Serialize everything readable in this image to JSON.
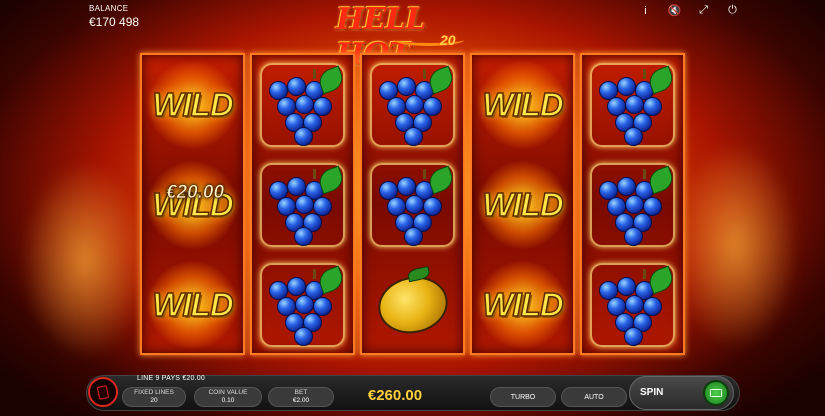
{
  "balance": {
    "label": "BALANCE",
    "value": "€170 498"
  },
  "logo": {
    "title": "HELL HOT",
    "number": "20"
  },
  "toolbar": {
    "info": "i",
    "mute": "🔇",
    "fullscreen": "⤢",
    "power": "⏻"
  },
  "reels": [
    [
      "wild",
      "wild",
      "wild"
    ],
    [
      "grape",
      "grape",
      "grape"
    ],
    [
      "grape",
      "grape",
      "lemon"
    ],
    [
      "wild",
      "wild",
      "wild"
    ],
    [
      "grape",
      "grape",
      "grape"
    ]
  ],
  "symbol_text": {
    "wild": "WILD"
  },
  "line_win_value": "€20.00",
  "message": "LINE 9 PAYS €20.00",
  "bottom": {
    "fixed_lines_label": "FIXED LINES",
    "fixed_lines_value": "20",
    "coin_value_label": "COIN VALUE",
    "coin_value": "0.10",
    "bet_label": "BET",
    "bet_value": "€2.00",
    "win": "€260.00",
    "turbo": "TURBO",
    "auto": "AUTO",
    "spin": "SPIN"
  },
  "colors": {
    "accent": "#ffcf3a",
    "reel_border": "#ff7a20",
    "cards_red": "#e0251a",
    "spin_green": "#4cd04c"
  }
}
